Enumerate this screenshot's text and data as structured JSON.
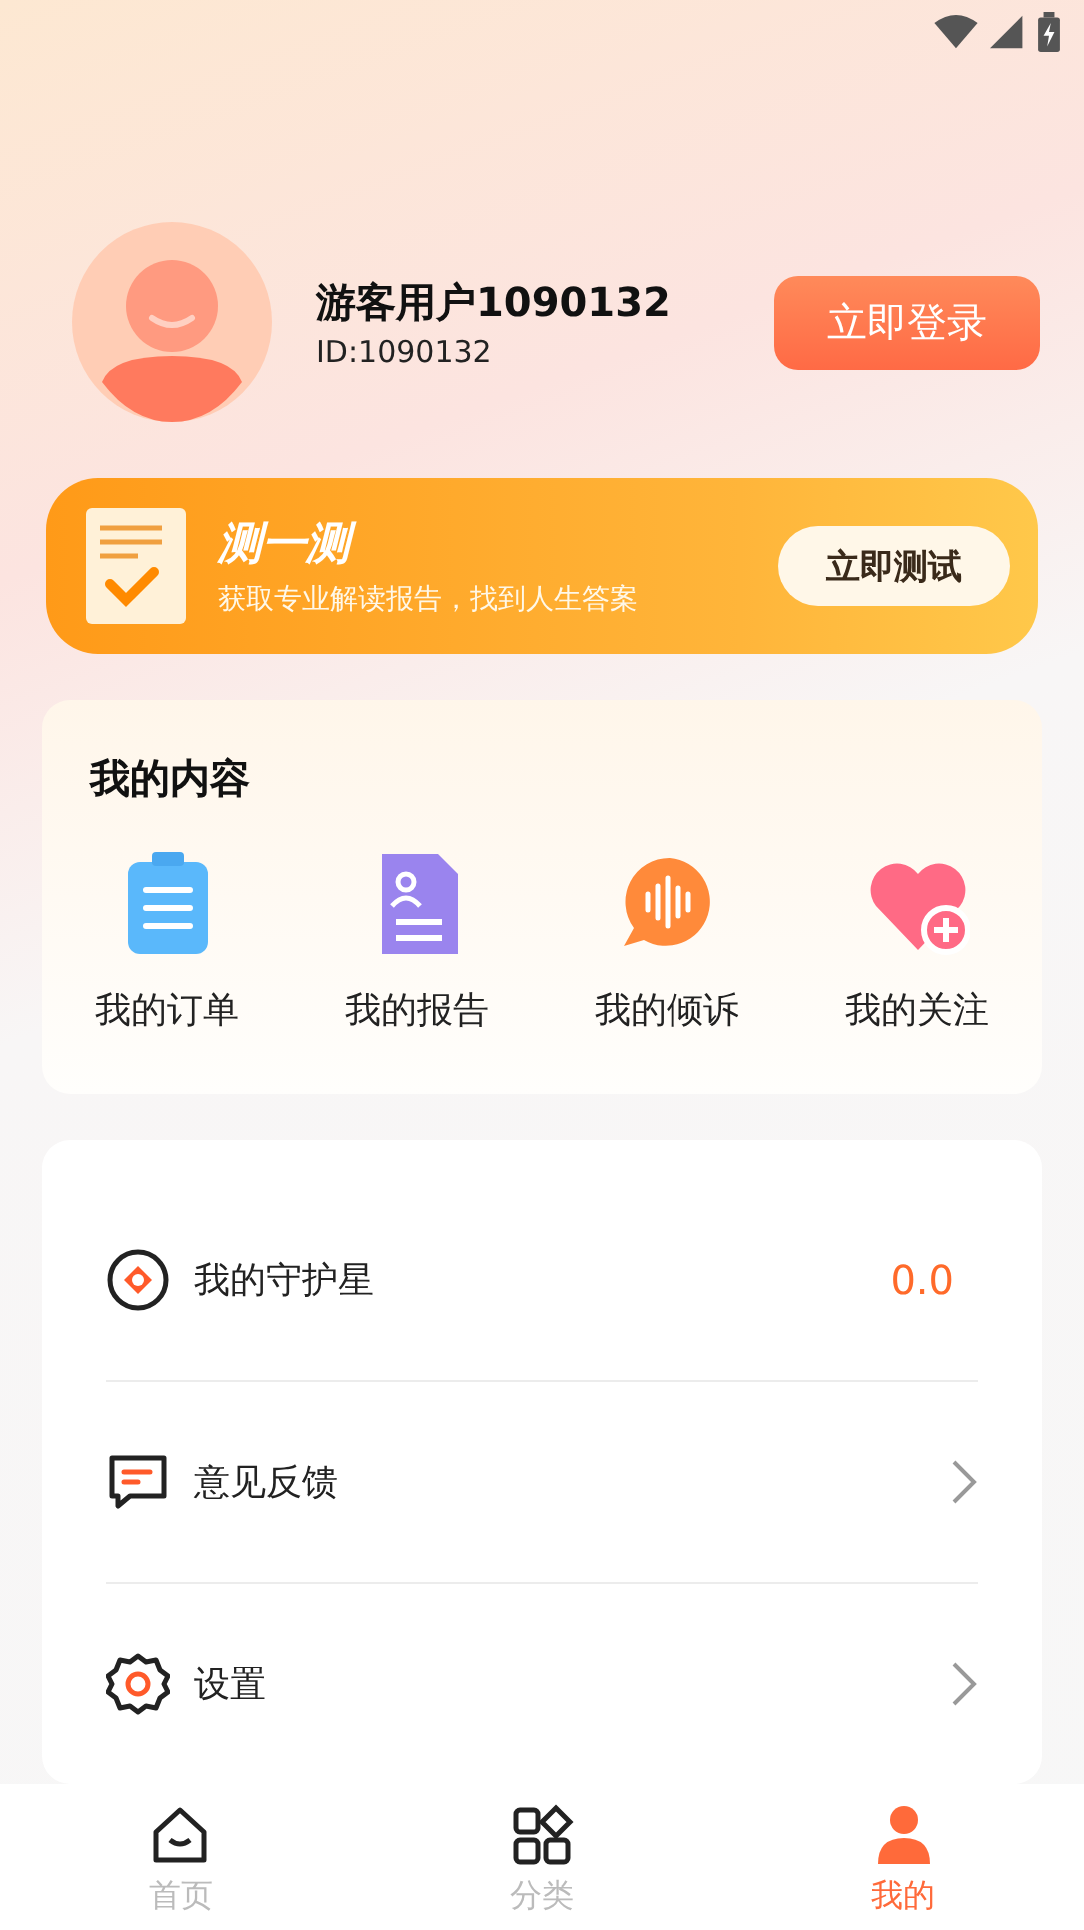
{
  "profile": {
    "name": "游客用户1090132",
    "id": "ID:1090132",
    "login_button": "立即登录"
  },
  "banner": {
    "title": "测一测",
    "subtitle": "获取专业解读报告，找到人生答案",
    "button": "立即测试"
  },
  "my_content": {
    "title": "我的内容",
    "items": [
      {
        "label": "我的订单",
        "kind": "order"
      },
      {
        "label": "我的报告",
        "kind": "report"
      },
      {
        "label": "我的倾诉",
        "kind": "voice"
      },
      {
        "label": "我的关注",
        "kind": "follow"
      }
    ]
  },
  "menu": [
    {
      "label": "我的守护星",
      "kind": "star",
      "value": "0.0"
    },
    {
      "label": "意见反馈",
      "kind": "feedback"
    },
    {
      "label": "设置",
      "kind": "settings"
    }
  ],
  "tab_bar": [
    {
      "label": "首页",
      "kind": "home",
      "selected": false
    },
    {
      "label": "分类",
      "kind": "category",
      "selected": false
    },
    {
      "label": "我的",
      "kind": "me",
      "selected": true
    }
  ]
}
